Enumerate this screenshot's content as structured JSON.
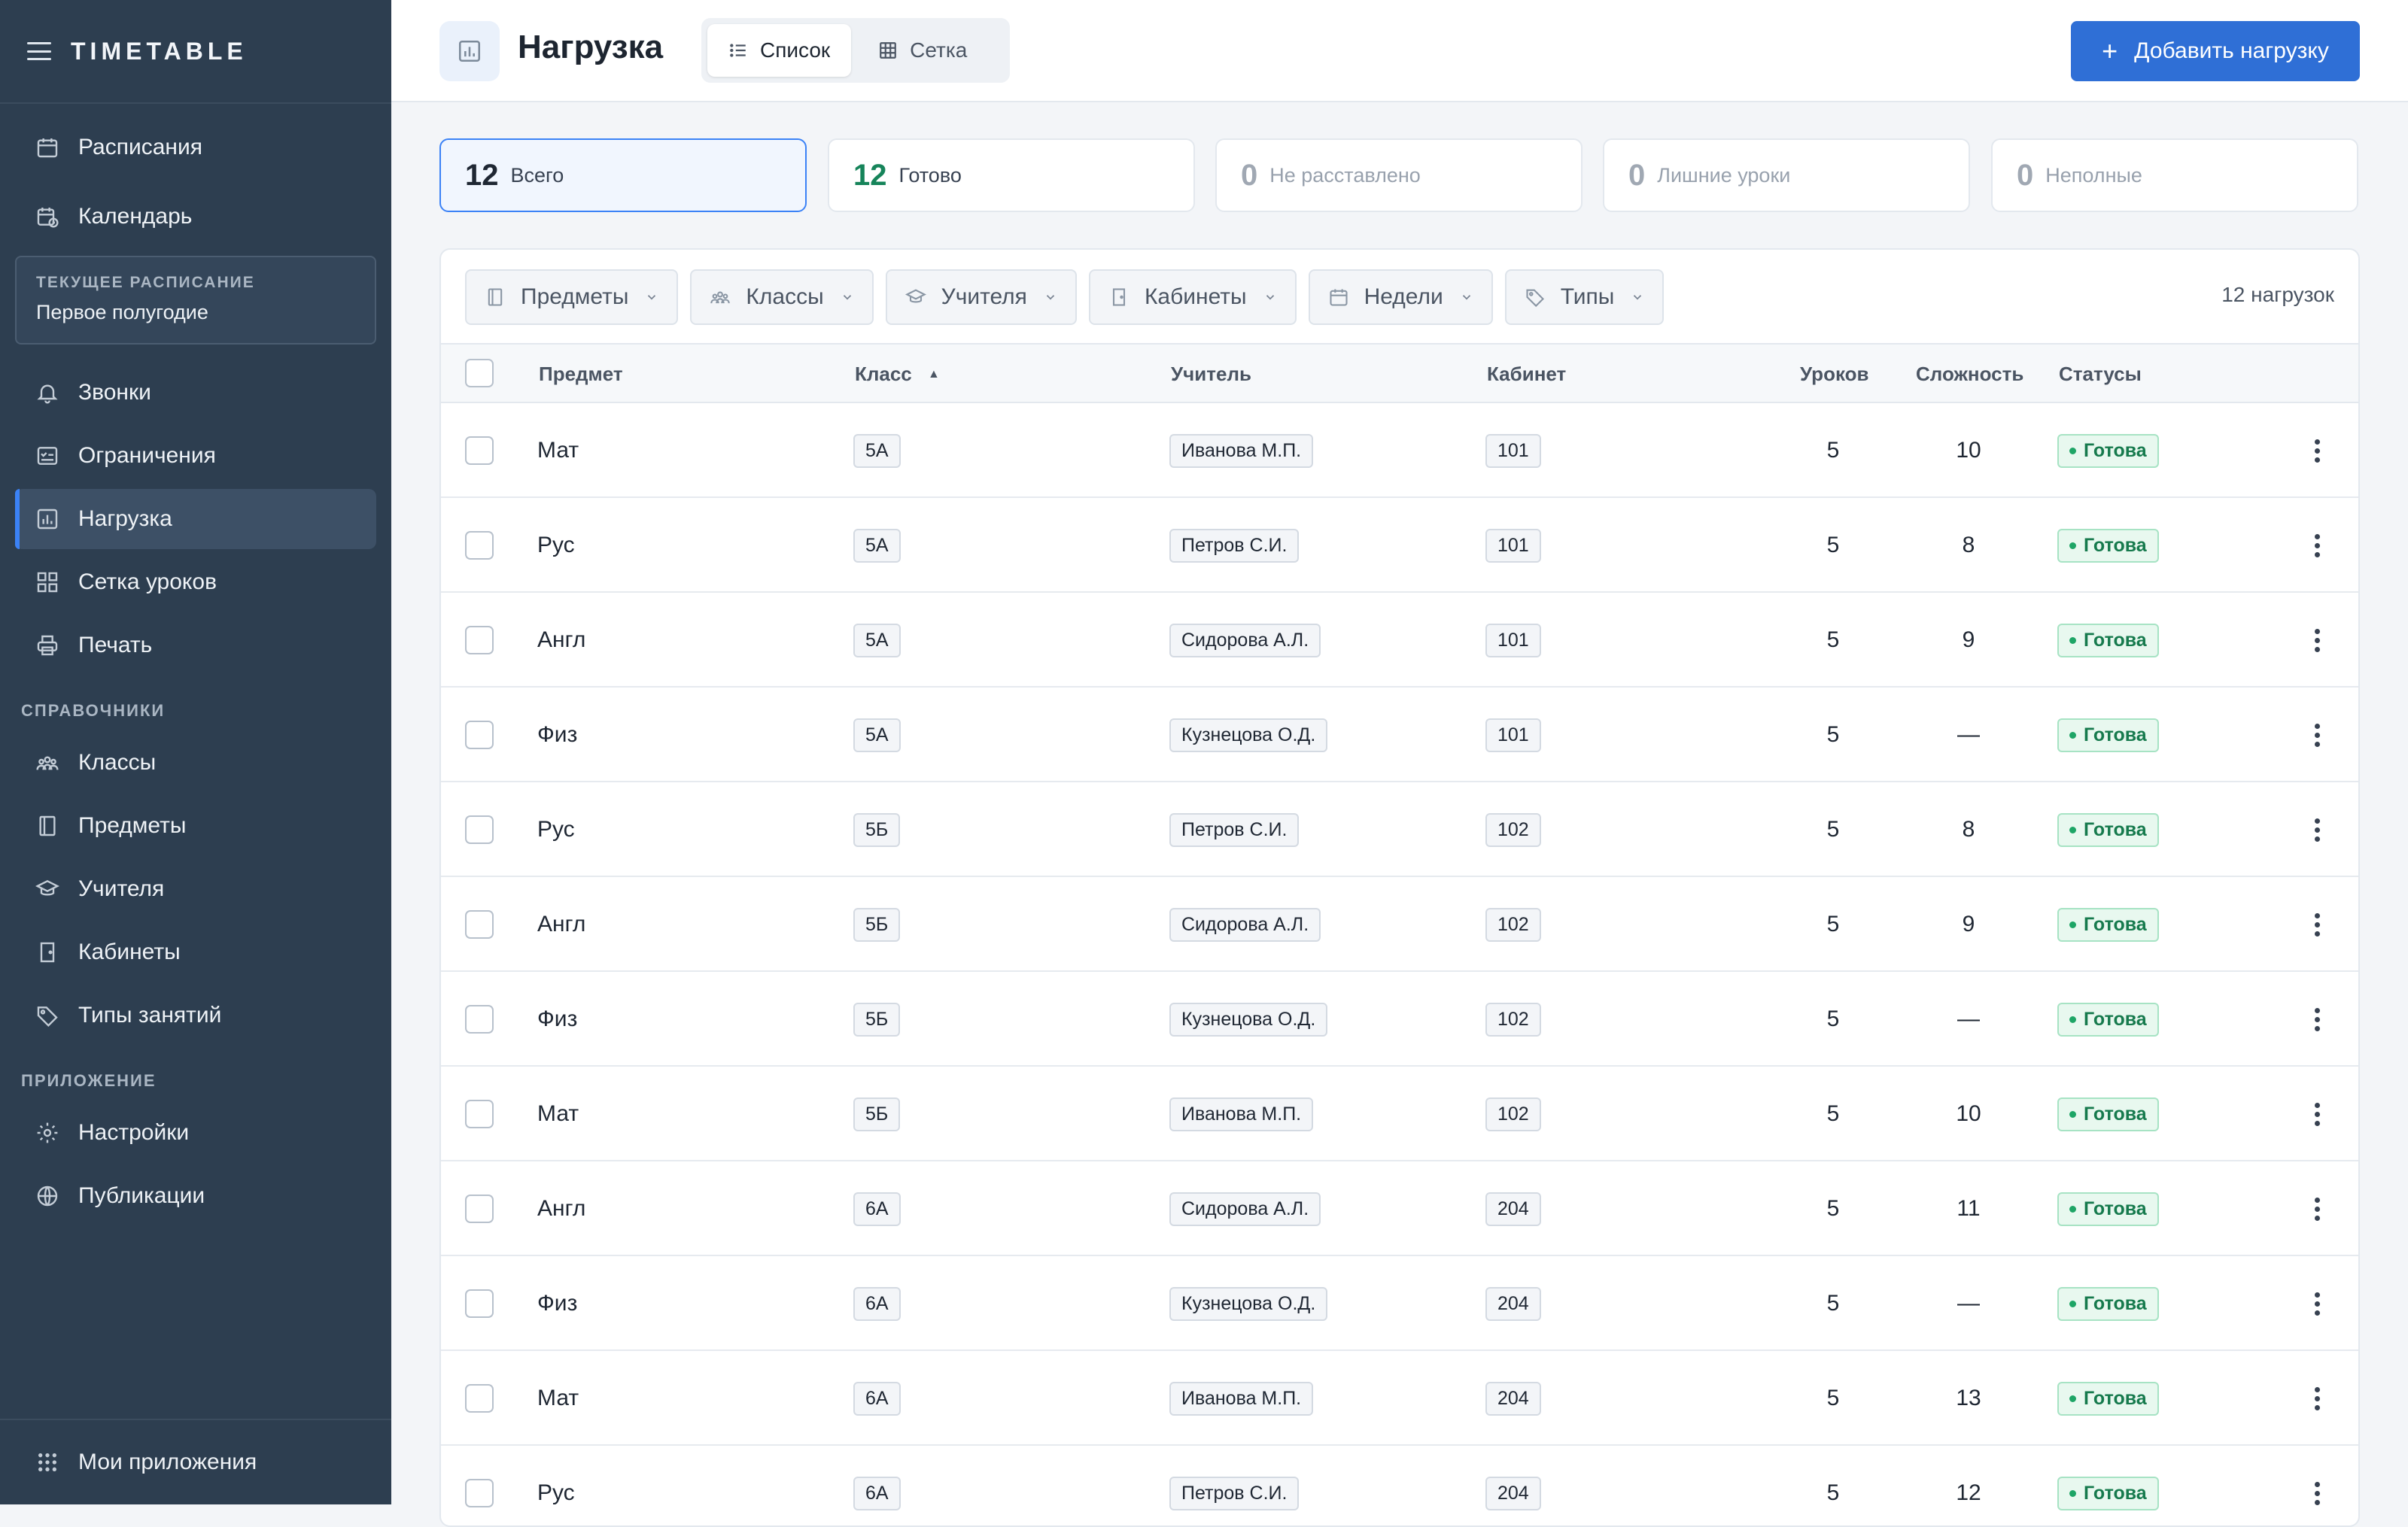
{
  "app": {
    "title": "TIMETABLE"
  },
  "sidebar": {
    "top_items": [
      {
        "label": "Расписания",
        "icon": "calendar-icon"
      },
      {
        "label": "Календарь",
        "icon": "calendar-clock-icon"
      }
    ],
    "current": {
      "label": "ТЕКУЩЕЕ РАСПИСАНИЕ",
      "value": "Первое полугодие"
    },
    "schedule_items": [
      {
        "label": "Звонки",
        "icon": "bell-icon"
      },
      {
        "label": "Ограничения",
        "icon": "checklist-icon"
      },
      {
        "label": "Нагрузка",
        "icon": "bar-chart-icon",
        "active": true
      },
      {
        "label": "Сетка уроков",
        "icon": "grid-icon"
      },
      {
        "label": "Печать",
        "icon": "printer-icon"
      }
    ],
    "section_reference": "СПРАВОЧНИКИ",
    "reference_items": [
      {
        "label": "Классы",
        "icon": "group-icon"
      },
      {
        "label": "Предметы",
        "icon": "book-icon"
      },
      {
        "label": "Учителя",
        "icon": "graduation-cap-icon"
      },
      {
        "label": "Кабинеты",
        "icon": "door-icon"
      },
      {
        "label": "Типы занятий",
        "icon": "tag-icon"
      }
    ],
    "section_app": "ПРИЛОЖЕНИЕ",
    "app_items": [
      {
        "label": "Настройки",
        "icon": "gear-icon"
      },
      {
        "label": "Публикации",
        "icon": "globe-icon"
      }
    ],
    "footer": {
      "label": "Мои приложения",
      "icon": "apps-grid-icon"
    }
  },
  "header": {
    "title": "Нагрузка",
    "views": [
      {
        "label": "Список",
        "selected": true
      },
      {
        "label": "Сетка",
        "selected": false
      }
    ],
    "add_button": "Добавить нагрузку"
  },
  "stats": [
    {
      "value": "12",
      "label": "Всего"
    },
    {
      "value": "12",
      "label": "Готово"
    },
    {
      "value": "0",
      "label": "Не расставлено"
    },
    {
      "value": "0",
      "label": "Лишние уроки"
    },
    {
      "value": "0",
      "label": "Неполные"
    }
  ],
  "filters": [
    "Предметы",
    "Классы",
    "Учителя",
    "Кабинеты",
    "Недели",
    "Типы"
  ],
  "count_label": "12 нагрузок",
  "columns": {
    "subject": "Предмет",
    "class": "Класс",
    "teacher": "Учитель",
    "room": "Кабинет",
    "lessons": "Уроков",
    "difficulty": "Сложность",
    "status": "Статусы"
  },
  "rows": [
    {
      "subject": "Мат",
      "class": "5А",
      "teacher": "Иванова М.П.",
      "room": "101",
      "lessons": "5",
      "difficulty": "10",
      "status": "Готова"
    },
    {
      "subject": "Рус",
      "class": "5А",
      "teacher": "Петров С.И.",
      "room": "101",
      "lessons": "5",
      "difficulty": "8",
      "status": "Готова"
    },
    {
      "subject": "Англ",
      "class": "5А",
      "teacher": "Сидорова А.Л.",
      "room": "101",
      "lessons": "5",
      "difficulty": "9",
      "status": "Готова"
    },
    {
      "subject": "Физ",
      "class": "5А",
      "teacher": "Кузнецова О.Д.",
      "room": "101",
      "lessons": "5",
      "difficulty": "—",
      "status": "Готова"
    },
    {
      "subject": "Рус",
      "class": "5Б",
      "teacher": "Петров С.И.",
      "room": "102",
      "lessons": "5",
      "difficulty": "8",
      "status": "Готова"
    },
    {
      "subject": "Англ",
      "class": "5Б",
      "teacher": "Сидорова А.Л.",
      "room": "102",
      "lessons": "5",
      "difficulty": "9",
      "status": "Готова"
    },
    {
      "subject": "Физ",
      "class": "5Б",
      "teacher": "Кузнецова О.Д.",
      "room": "102",
      "lessons": "5",
      "difficulty": "—",
      "status": "Готова"
    },
    {
      "subject": "Мат",
      "class": "5Б",
      "teacher": "Иванова М.П.",
      "room": "102",
      "lessons": "5",
      "difficulty": "10",
      "status": "Готова"
    },
    {
      "subject": "Англ",
      "class": "6А",
      "teacher": "Сидорова А.Л.",
      "room": "204",
      "lessons": "5",
      "difficulty": "11",
      "status": "Готова"
    },
    {
      "subject": "Физ",
      "class": "6А",
      "teacher": "Кузнецова О.Д.",
      "room": "204",
      "lessons": "5",
      "difficulty": "—",
      "status": "Готова"
    },
    {
      "subject": "Мат",
      "class": "6А",
      "teacher": "Иванова М.П.",
      "room": "204",
      "lessons": "5",
      "difficulty": "13",
      "status": "Готова"
    },
    {
      "subject": "Рус",
      "class": "6А",
      "teacher": "Петров С.И.",
      "room": "204",
      "lessons": "5",
      "difficulty": "12",
      "status": "Готова"
    }
  ]
}
